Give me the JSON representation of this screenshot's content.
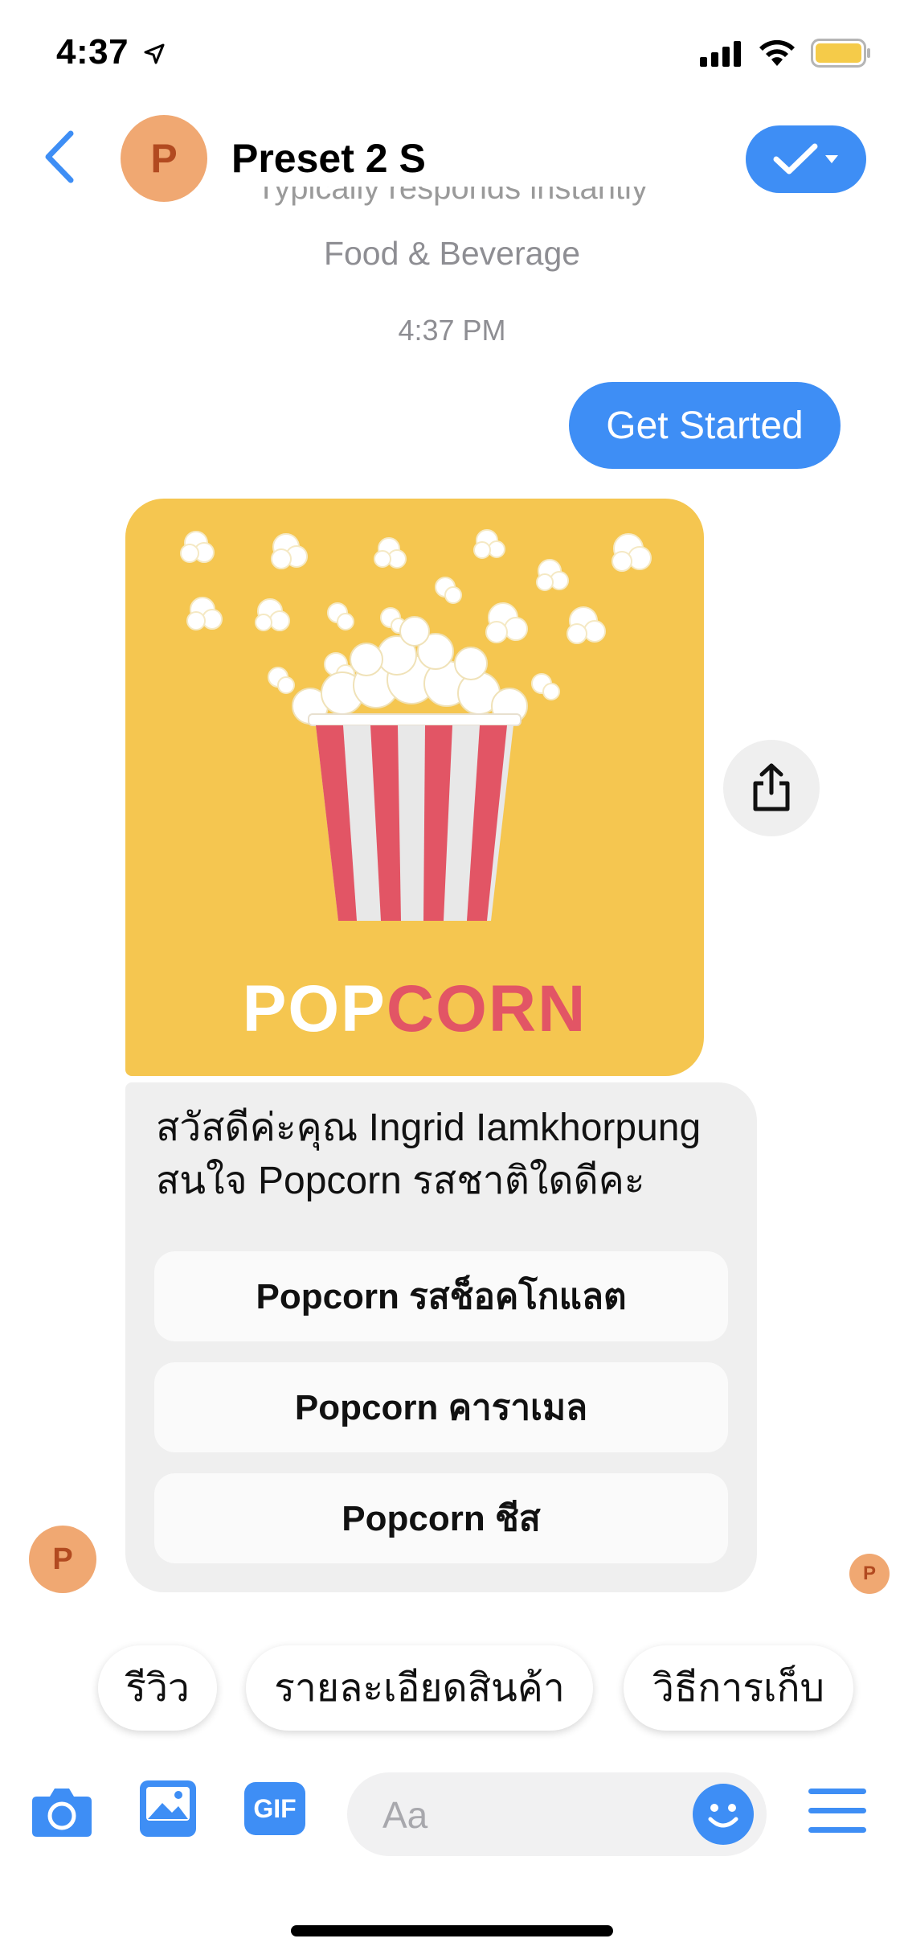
{
  "status_bar": {
    "time": "4:37"
  },
  "header": {
    "avatar_letter": "P",
    "title": "Preset 2 S",
    "subtitle": "Typically responds instantly",
    "category": "Food & Beverage"
  },
  "conversation": {
    "timestamp": "4:37 PM",
    "outgoing_message": "Get Started",
    "card": {
      "image_logo_text": "POPCORN",
      "message": "สวัสดีค่ะคุณ Ingrid Iamkhorpung สนใจ Popcorn รสชาติใดดีคะ",
      "buttons": [
        {
          "label": "Popcorn รสช็อคโกแลต"
        },
        {
          "label": "Popcorn คาราเมล"
        },
        {
          "label": "Popcorn ชีส"
        }
      ]
    },
    "sender_avatar_letter": "P",
    "seen_avatar_letter": "P"
  },
  "quick_replies": [
    {
      "label": "รีวิว"
    },
    {
      "label": "รายละเอียดสินค้า"
    },
    {
      "label": "วิธีการเก็บ"
    }
  ],
  "composer": {
    "placeholder": "Aa",
    "gif_label": "GIF",
    "icons": [
      "camera-icon",
      "photo-icon",
      "gif-icon",
      "emoji-icon",
      "menu-icon"
    ]
  },
  "colors": {
    "accent": "#3E8EF5",
    "avatar_bg": "#F0A872",
    "card_image_bg": "#F5C650",
    "card_bg": "#EFEFEF"
  }
}
